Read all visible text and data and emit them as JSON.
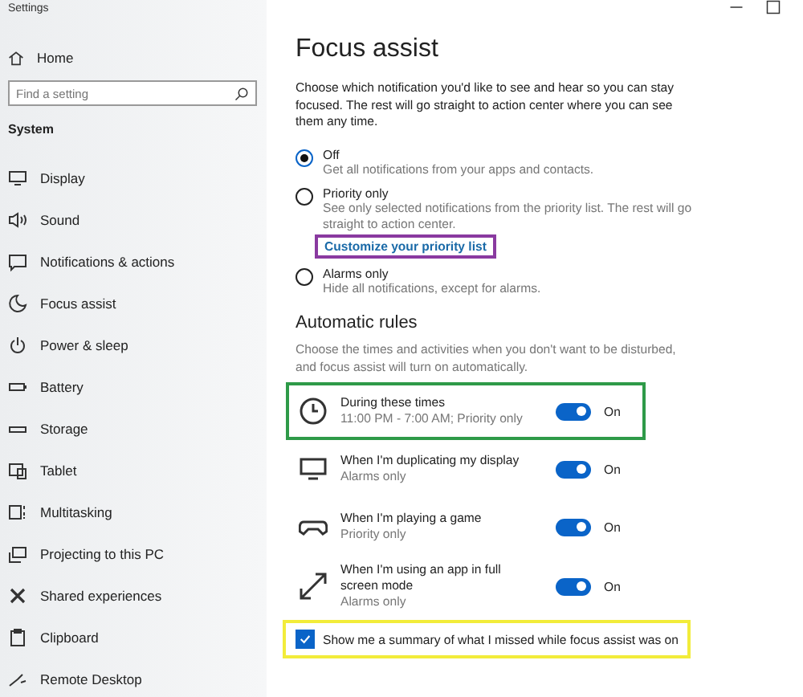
{
  "window": {
    "title": "Settings"
  },
  "sidebar": {
    "home": "Home",
    "search": {
      "placeholder": "Find a setting"
    },
    "section": "System",
    "items": [
      {
        "label": "Display",
        "selected": false
      },
      {
        "label": "Sound",
        "selected": false
      },
      {
        "label": "Notifications & actions",
        "selected": false
      },
      {
        "label": "Focus assist",
        "selected": false
      },
      {
        "label": "Power & sleep",
        "selected": false
      },
      {
        "label": "Battery",
        "selected": false
      },
      {
        "label": "Storage",
        "selected": false
      },
      {
        "label": "Tablet",
        "selected": false
      },
      {
        "label": "Multitasking",
        "selected": false
      },
      {
        "label": "Projecting to this PC",
        "selected": false
      },
      {
        "label": "Shared experiences",
        "selected": false
      },
      {
        "label": "Clipboard",
        "selected": false
      },
      {
        "label": "Remote Desktop",
        "selected": false
      }
    ]
  },
  "page": {
    "title": "Focus assist",
    "description": "Choose which notification you'd like to see and hear so you can stay focused. The rest will go straight to action center where you can see them any time.",
    "options": [
      {
        "label": "Off",
        "detail": "Get all notifications from your apps and contacts.",
        "selected": true
      },
      {
        "label": "Priority only",
        "detail": "See only selected notifications from the priority list. The rest will go straight to action center.",
        "selected": false,
        "link": {
          "text": "Customize your priority list",
          "color": "#8a3aa0"
        }
      },
      {
        "label": "Alarms only",
        "detail": "Hide all notifications, except for alarms.",
        "selected": false
      }
    ],
    "rules_heading": "Automatic rules",
    "rules_description": "Choose the times and activities when you don't want to be disturbed, and focus assist will turn on automatically.",
    "rules": [
      {
        "title": "During these times",
        "detail": "11:00 PM - 7:00 AM; Priority only",
        "on": true,
        "state": "On",
        "color": "#2e9a48"
      },
      {
        "title": "When I'm duplicating my display",
        "detail": "Alarms only",
        "on": true,
        "state": "On"
      },
      {
        "title": "When I'm playing a game",
        "detail": "Priority only",
        "on": true,
        "state": "On"
      },
      {
        "title": "When I'm using an app in full screen mode",
        "detail": "Alarms only",
        "on": true,
        "state": "On"
      }
    ],
    "summary": {
      "label": "Show me a summary of what I missed while focus assist was on",
      "checked": true,
      "color": "#f2ec3a"
    }
  }
}
